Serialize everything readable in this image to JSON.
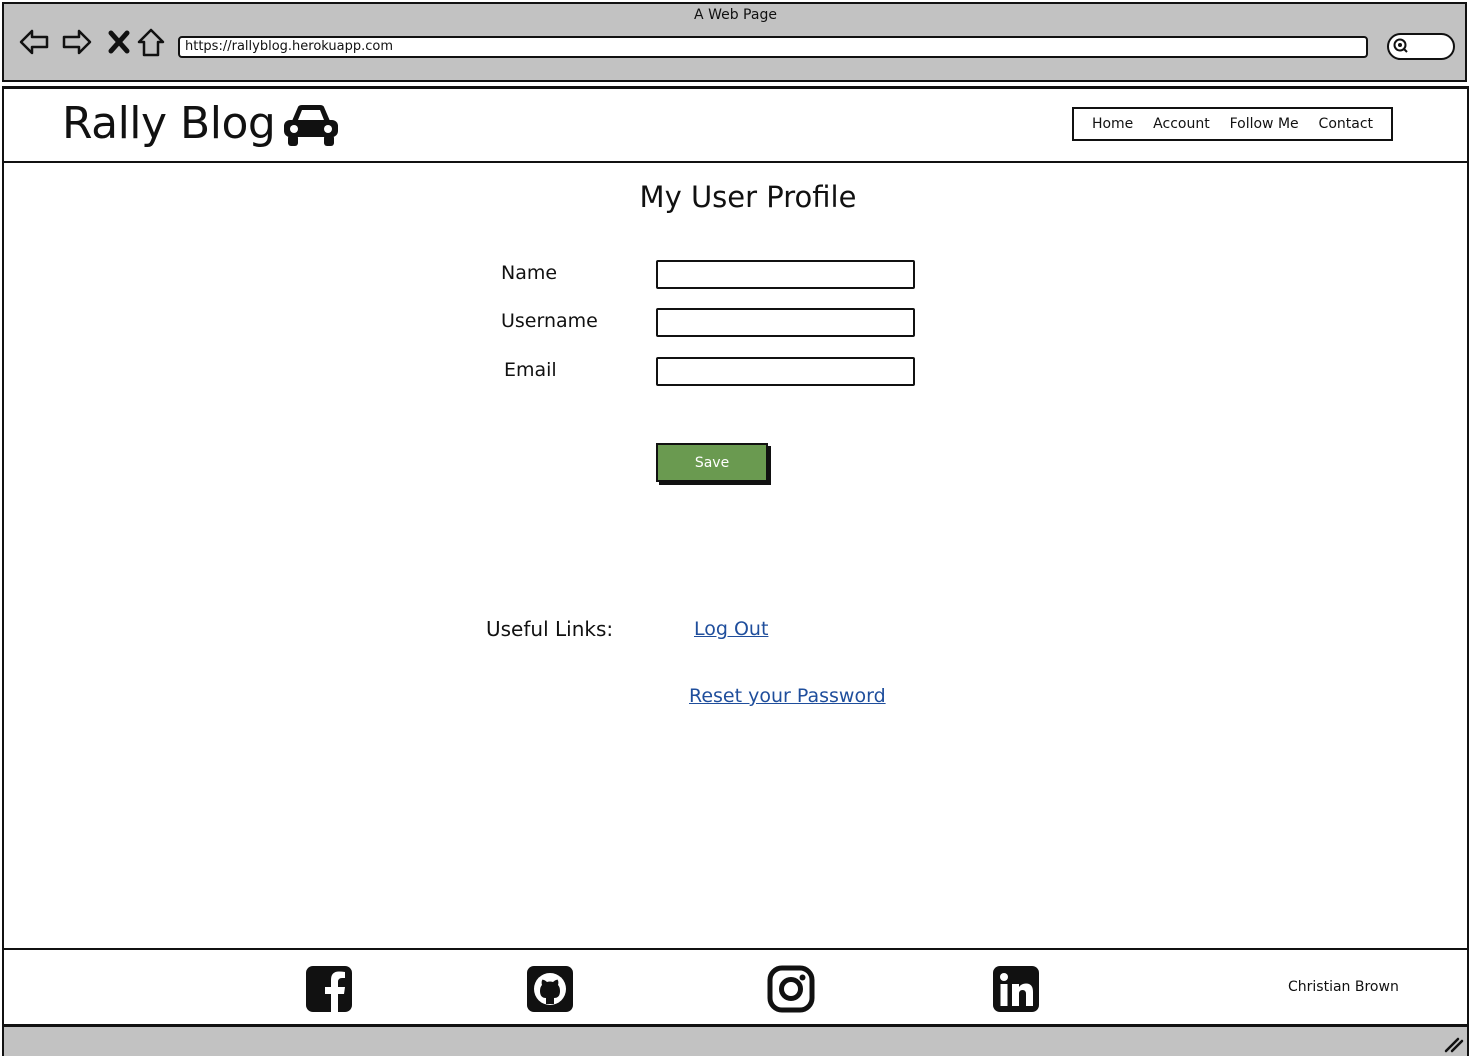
{
  "browser": {
    "window_title": "A Web Page",
    "url": "https://rallyblog.herokuapp.com",
    "icons": [
      "back-arrow-icon",
      "forward-arrow-icon",
      "stop-icon",
      "home-icon",
      "search-icon"
    ]
  },
  "header": {
    "brand": "Rally Blog",
    "brand_icon": "car-icon",
    "nav": [
      "Home",
      "Account",
      "Follow Me",
      "Contact"
    ]
  },
  "main": {
    "title": "My User Profile",
    "fields": [
      {
        "label": "Name",
        "value": ""
      },
      {
        "label": "Username",
        "value": ""
      },
      {
        "label": "Email",
        "value": ""
      }
    ],
    "save_label": "Save",
    "save_color": "#6a9a50",
    "useful_links_label": "Useful Links:",
    "links": [
      "Log Out",
      "Reset your Password"
    ],
    "link_color": "#1f4e9c"
  },
  "footer": {
    "social_icons": [
      "facebook-icon",
      "github-icon",
      "instagram-icon",
      "linkedin-icon"
    ],
    "author": "Christian Brown"
  }
}
